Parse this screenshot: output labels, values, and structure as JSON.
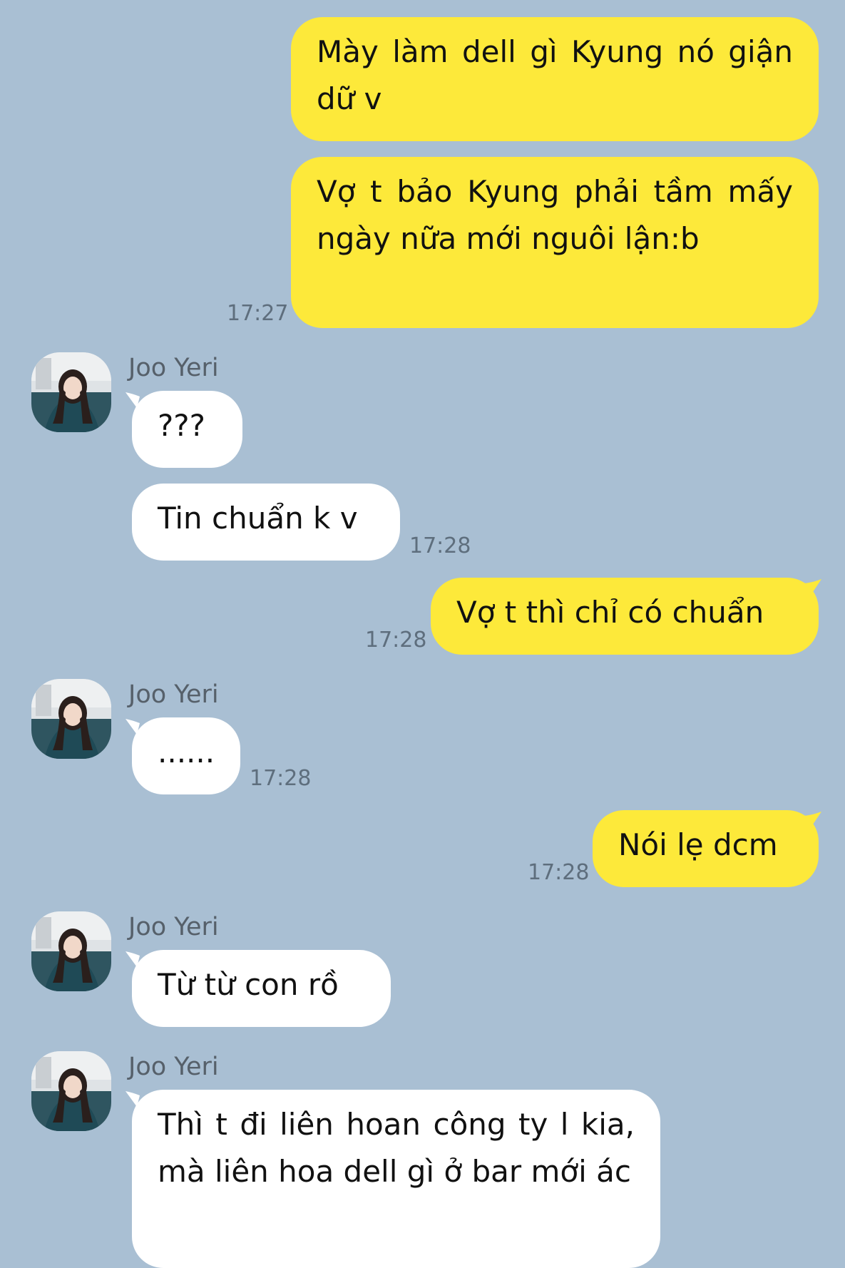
{
  "chat": {
    "contact_name": "Joo Yeri",
    "messages": [
      {
        "side": "out",
        "text": "Mày làm dell gì Kyung nó giận dữ v"
      },
      {
        "side": "out",
        "text": "Vợ t bảo Kyung phải tầm mấy ngày nữa mới nguôi lận:b",
        "time": "17:27"
      },
      {
        "side": "in",
        "sender": "Joo Yeri",
        "text": "???"
      },
      {
        "side": "in",
        "text": "Tin chuẩn k v",
        "time": "17:28"
      },
      {
        "side": "out",
        "text": "Vợ t thì chỉ có chuẩn",
        "time": "17:28"
      },
      {
        "side": "in",
        "sender": "Joo Yeri",
        "text": "......",
        "time": "17:28"
      },
      {
        "side": "out",
        "text": "Nói lẹ dcm",
        "time": "17:28"
      },
      {
        "side": "in",
        "sender": "Joo Yeri",
        "text": "Từ từ con rồ"
      },
      {
        "side": "in",
        "sender": "Joo Yeri",
        "text": "Thì t đi liên hoan công ty l kia, mà liên hoa dell gì ở bar mới ác"
      }
    ]
  },
  "colors": {
    "background": "#a9bfd3",
    "outgoing_bubble": "#fde93a",
    "incoming_bubble": "#ffffff"
  }
}
